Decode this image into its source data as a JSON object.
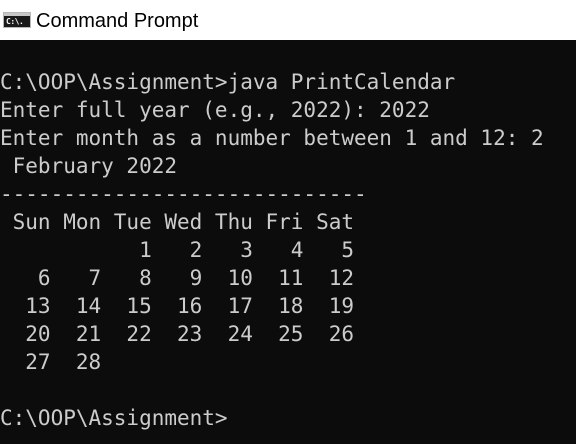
{
  "window": {
    "title": "Command Prompt",
    "icon": "command-prompt-icon",
    "icon_glyph": "C:\\."
  },
  "console": {
    "lines": [
      "",
      "C:\\OOP\\Assignment>java PrintCalendar",
      "Enter full year (e.g., 2022): 2022",
      "Enter month as a number between 1 and 12: 2",
      " February 2022",
      "-----------------------------",
      " Sun Mon Tue Wed Thu Fri Sat",
      "           1   2   3   4   5",
      "   6   7   8   9  10  11  12",
      "  13  14  15  16  17  18  19",
      "  20  21  22  23  24  25  26",
      "  27  28",
      "",
      "C:\\OOP\\Assignment>"
    ]
  },
  "colors": {
    "console_background": "#0c0c0c",
    "console_text": "#cccccc",
    "titlebar_background": "#ffffff"
  }
}
